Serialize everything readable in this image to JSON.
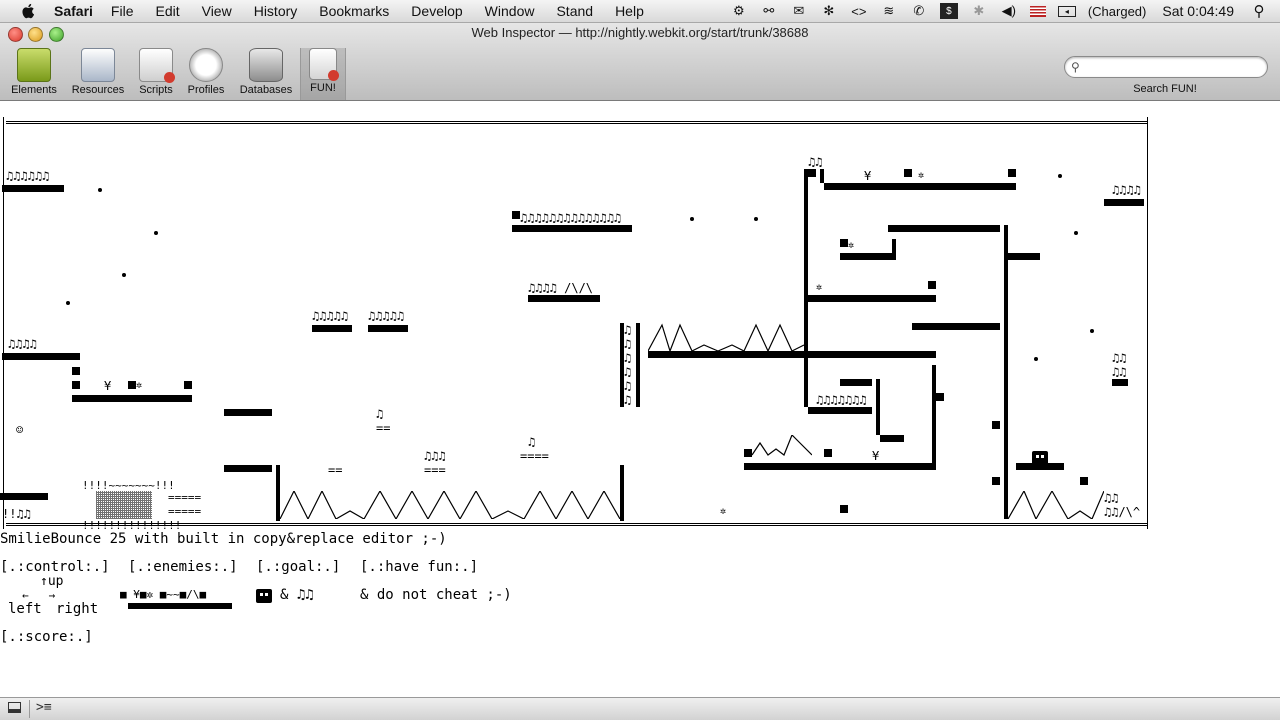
{
  "menubar": {
    "app_name": "Safari",
    "menus": [
      "File",
      "Edit",
      "View",
      "History",
      "Bookmarks",
      "Develop",
      "Window",
      "Stand",
      "Help"
    ],
    "battery_status": "(Charged)",
    "clock": "Sat 0:04:49"
  },
  "window": {
    "title": "Web Inspector — http://nightly.webkit.org/start/trunk/38688"
  },
  "toolbar": {
    "tools": [
      "Elements",
      "Resources",
      "Scripts",
      "Profiles",
      "Databases",
      "FUN!"
    ],
    "search_placeholder": "",
    "search_label": "Search FUN!"
  },
  "game": {
    "caption": "SmilieBounce 25 with built in copy&replace editor ;-)",
    "legend": {
      "control_label": "[.:control:.]",
      "enemies_label": "[.:enemies:.]",
      "goal_label": "[.:goal:.]",
      "fun_label": "[.:have fun:.]",
      "up": "↑up",
      "arrows": "←   →",
      "left": "left",
      "right": "right",
      "enemies_glyphs": "■ ¥■✲ ■~~■/\\■",
      "goal_glyphs": "& ♫♫",
      "cheat": "& do not cheat ;-)",
      "score_label": "[.:score:.]"
    },
    "glyphs": {
      "notes_6": "♫♫♫♫♫♫",
      "notes_4": "♫♫♫♫",
      "notes_5": "♫♫♫♫♫",
      "notes_top": "♫♫♫♫♫♫♫♫♫♫♫♫♫♫",
      "notes_spike": "♫♫♫♫ /\\/\\",
      "notes_2": "♫♫",
      "notes_3": "♫♫♫",
      "notes_7": "♫♫♫♫♫♫♫",
      "note_1": "♫",
      "yen": "¥",
      "sun": "✲",
      "smilie": "☺",
      "eq2": "==",
      "eq3": "===",
      "eq4": "====",
      "spring": "!!!!~~~~~~~!!!",
      "spring_base": "!!!!!!!!!!!!!!!",
      "dash": "=====",
      "bottom_bars": "!!♫♫"
    }
  }
}
